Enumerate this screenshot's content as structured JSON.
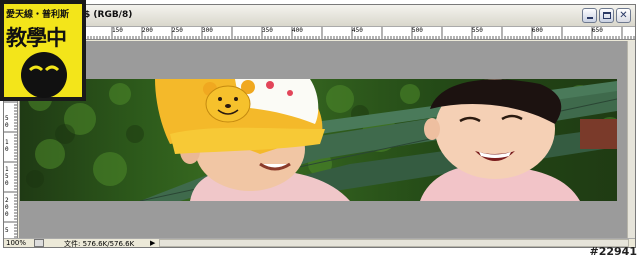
{
  "window": {
    "title": "$ (RGB/8)"
  },
  "ruler": {
    "top_labels": [
      "150",
      "200",
      "250",
      "300",
      "350",
      "400",
      "450",
      "500",
      "550",
      "600",
      "650"
    ],
    "left_labels": [
      "5",
      "0",
      "5",
      "0",
      "1",
      "0",
      "1",
      "5",
      "0",
      "2",
      "0",
      "0",
      "5"
    ]
  },
  "status": {
    "zoom": "100%",
    "doc_size": "文件: 576.6K/576.6K",
    "arrow": "▶"
  },
  "logo": {
    "top_text": "愛天線・普利斯",
    "main_text": "教學中"
  },
  "watermark": "#22941",
  "icons": [
    "minimize-icon",
    "maximize-icon",
    "close-icon",
    "doc-info-icon",
    "arrow-right-icon"
  ]
}
